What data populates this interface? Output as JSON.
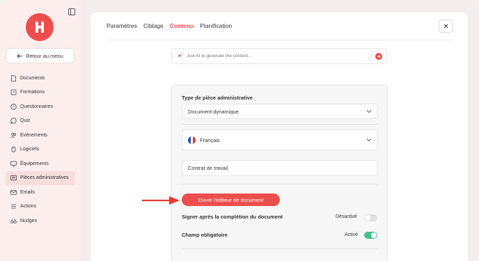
{
  "sidebar": {
    "back_label": "Retour au menu",
    "items": [
      {
        "label": "Documents",
        "icon": "document-icon"
      },
      {
        "label": "Formations",
        "icon": "folder-icon"
      },
      {
        "label": "Questionnaires",
        "icon": "question-icon"
      },
      {
        "label": "Quiz",
        "icon": "chat-icon"
      },
      {
        "label": "Événements",
        "icon": "users-icon"
      },
      {
        "label": "Logiciels",
        "icon": "mouse-icon"
      },
      {
        "label": "Équipements",
        "icon": "monitor-icon"
      },
      {
        "label": "Pièces administratives",
        "icon": "id-card-icon",
        "active": true
      },
      {
        "label": "Emails",
        "icon": "mail-icon"
      },
      {
        "label": "Actions",
        "icon": "list-icon"
      },
      {
        "label": "Nudges",
        "icon": "binoculars-icon"
      }
    ]
  },
  "tabs": [
    {
      "label": "Paramètres"
    },
    {
      "label": "Ciblage"
    },
    {
      "label": "Contenu",
      "active": true
    },
    {
      "label": "Planification"
    }
  ],
  "ai": {
    "placeholder": "Ask AI to generate the content..."
  },
  "form": {
    "type_label": "Type de pièce administrative",
    "type_value": "Document dynamique",
    "language_value": "Français",
    "title_value": "Contrat de travail",
    "open_editor_label": "Ouvrir l'éditeur de document",
    "sign_label": "Signer après la complétion du document",
    "sign_state": "Désactivé",
    "sign_on": false,
    "required_label": "Champ obligatoire",
    "required_state": "Activé",
    "required_on": true
  },
  "colors": {
    "accent": "#ee4d4d",
    "toggle_on": "#3fbf8a"
  }
}
